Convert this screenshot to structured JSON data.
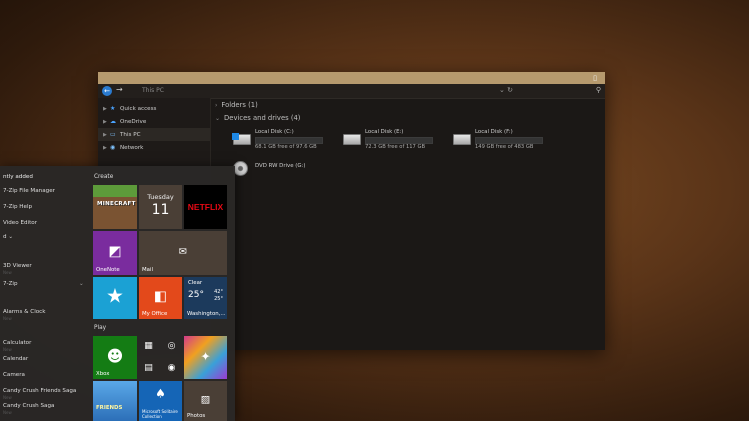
{
  "explorer": {
    "address": "This PC",
    "titlebar_control": "▯",
    "nav": [
      {
        "label": "Quick access",
        "icon": "star-icon"
      },
      {
        "label": "OneDrive",
        "icon": "cloud-icon"
      },
      {
        "label": "This PC",
        "icon": "computer-icon"
      },
      {
        "label": "Network",
        "icon": "network-icon"
      }
    ],
    "groups": {
      "folders": "Folders (1)",
      "devices": "Devices and drives (4)"
    },
    "drives": [
      {
        "name": "Local Disk (C:)",
        "free": "68.1 GB free of 97.6 GB",
        "used_fraction": 0.3
      },
      {
        "name": "Local Disk (E:)",
        "free": "72.3 GB free of 117 GB",
        "used_fraction": 0.38
      },
      {
        "name": "Local Disk (F:)",
        "free": "149 GB free of 483 GB",
        "used_fraction": 0.69
      },
      {
        "name": "DVD RW Drive (G:)"
      }
    ]
  },
  "start": {
    "recently_added": "ntly added",
    "apps": [
      "7-Zip File Manager",
      "7-Zip Help",
      "Video Editor",
      "d",
      "3D Viewer",
      "New",
      "7-Zip",
      "Alarms & Clock",
      "New",
      "Calculator",
      "New",
      "Calendar",
      "Camera",
      "Candy Crush Friends Saga",
      "New",
      "Candy Crush Saga",
      "New"
    ],
    "sections": {
      "create": "Create",
      "play": "Play"
    },
    "tiles": {
      "minecraft": "MINECRAFT",
      "calendar_day": "Tuesday",
      "calendar_num": "11",
      "netflix": "NETFLIX",
      "onenote": "OneNote",
      "mail": "Mail",
      "office": "My Office",
      "weather_cond": "Clear",
      "weather_temp": "25°",
      "weather_hi": "42°",
      "weather_lo": "25°",
      "weather_city": "Washington,...",
      "xbox": "Xbox",
      "candy_friends": "FRIENDS",
      "solitaire": "Microsoft Solitaire Collection",
      "photos": "Photos"
    }
  },
  "colors": {
    "accent": "#b69a6e",
    "onenote": "#7a2c9e",
    "office": "#e3491b",
    "store": "#1ba1d4",
    "xbox": "#147c14"
  }
}
